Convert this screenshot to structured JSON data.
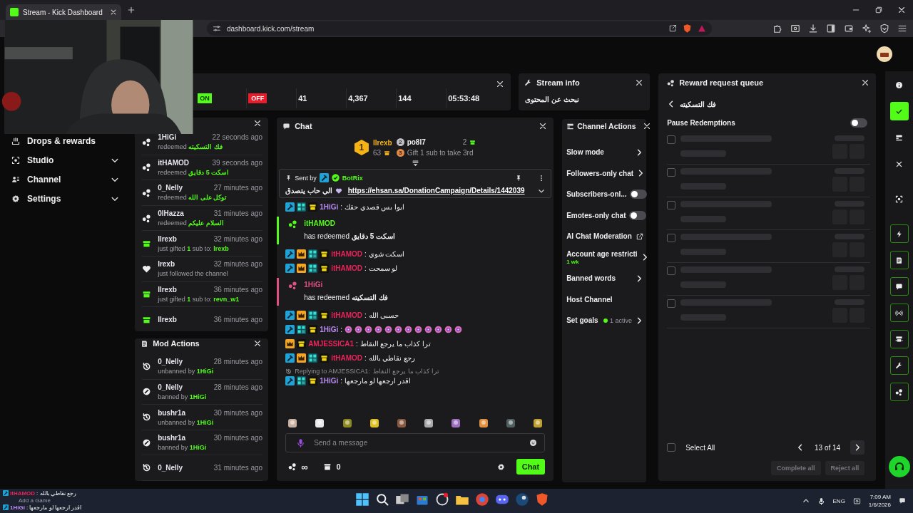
{
  "browser": {
    "tab_title": "Stream - Kick Dashboard",
    "url": "dashboard.kick.com/stream"
  },
  "sidebar": {
    "items": [
      {
        "label": "Drops & rewards",
        "expandable": false
      },
      {
        "label": "Studio",
        "expandable": true
      },
      {
        "label": "Channel",
        "expandable": true
      },
      {
        "label": "Settings",
        "expandable": true
      }
    ]
  },
  "stats": {
    "values": [
      {
        "kind": "status_on",
        "text": "ON"
      },
      {
        "kind": "status_off",
        "text": "OFF"
      },
      {
        "kind": "number",
        "text": "41"
      },
      {
        "kind": "number",
        "text": "4,367"
      },
      {
        "kind": "number",
        "text": "144"
      },
      {
        "kind": "number",
        "text": "05:53:48"
      }
    ]
  },
  "stream_info": {
    "title": "Stream info",
    "text": "نبحث عن المحتوى"
  },
  "activity_feed": {
    "items": [
      {
        "kind": "redeem",
        "user": "1HiGi",
        "time": "22 seconds ago",
        "line": [
          {
            "text": "redeemed ",
            "highlight": false
          },
          {
            "text": "فك التسكيته",
            "highlight": true
          }
        ]
      },
      {
        "kind": "redeem",
        "user": "itHAMOD",
        "time": "39 seconds ago",
        "line": [
          {
            "text": "redeemed ",
            "highlight": false
          },
          {
            "text": "اسكت 5 دقايق",
            "highlight": true
          }
        ]
      },
      {
        "kind": "redeem",
        "user": "0_Nelly",
        "time": "27 minutes ago",
        "line": [
          {
            "text": "redeemed ",
            "highlight": false
          },
          {
            "text": "توكل على الله",
            "highlight": true
          }
        ]
      },
      {
        "kind": "redeem",
        "user": "0lHazza",
        "time": "31 minutes ago",
        "line": [
          {
            "text": "redeemed ",
            "highlight": false
          },
          {
            "text": "السلام عليكم",
            "highlight": true
          }
        ]
      },
      {
        "kind": "gift",
        "user": "llrexb",
        "time": "32 minutes ago",
        "line": [
          {
            "text": "just gifted ",
            "highlight": false
          },
          {
            "text": "1",
            "highlight": true
          },
          {
            "text": " sub to: ",
            "highlight": false
          },
          {
            "text": "lrexb",
            "highlight": true
          }
        ]
      },
      {
        "kind": "follow",
        "user": "lrexb",
        "time": "32 minutes ago",
        "line": [
          {
            "text": "just followed the channel",
            "highlight": false
          }
        ]
      },
      {
        "kind": "gift",
        "user": "llrexb",
        "time": "36 minutes ago",
        "line": [
          {
            "text": "just gifted ",
            "highlight": false
          },
          {
            "text": "1",
            "highlight": true
          },
          {
            "text": " sub to: ",
            "highlight": false
          },
          {
            "text": "revn_w1",
            "highlight": true
          }
        ]
      },
      {
        "kind": "gift",
        "user": "llrexb",
        "time": "36 minutes ago"
      }
    ]
  },
  "mod_actions": {
    "title": "Mod Actions",
    "items": [
      {
        "kind": "unban",
        "user": "0_Nelly",
        "time": "28 minutes ago",
        "line": [
          {
            "text": "unbanned by ",
            "highlight": false
          },
          {
            "text": "1HiGi",
            "highlight": true
          }
        ]
      },
      {
        "kind": "ban",
        "user": "0_Nelly",
        "time": "28 minutes ago",
        "line": [
          {
            "text": "banned by ",
            "highlight": false
          },
          {
            "text": "1HiGi",
            "highlight": true
          }
        ]
      },
      {
        "kind": "unban",
        "user": "bushr1a",
        "time": "30 minutes ago",
        "line": [
          {
            "text": "unbanned by ",
            "highlight": false
          },
          {
            "text": "1HiGi",
            "highlight": true
          }
        ]
      },
      {
        "kind": "ban",
        "user": "bushr1a",
        "time": "30 minutes ago",
        "line": [
          {
            "text": "banned by ",
            "highlight": false
          },
          {
            "text": "1HiGi",
            "highlight": true
          }
        ]
      },
      {
        "kind": "unban",
        "user": "0_Nelly",
        "time": "31 minutes ago"
      }
    ]
  },
  "chat": {
    "title": "Chat",
    "leaderboard": [
      {
        "rank": "1",
        "user": "llrexb",
        "count": "63"
      },
      {
        "rank": "2",
        "user": "po8l7",
        "count": "2"
      },
      {
        "rank": "3",
        "text": "Gift 1 sub to take 3rd"
      }
    ],
    "pinned": {
      "label": "Sent by",
      "user": "BotRix",
      "text": "الي حاب يتصدق",
      "link": "https://ehsan.sa/DonationCampaign/Details/1442039"
    },
    "messages": [
      {
        "kind": "message",
        "badges": [
          {
            "kind": "mod"
          },
          {
            "kind": "og"
          },
          {
            "kind": "sub"
          }
        ],
        "user": "1HiGi",
        "color": "#b88cf0",
        "text": ": ايوا بس قصدي حقك"
      },
      {
        "kind": "redeem",
        "user": "itHAMOD",
        "color": "#53fc18",
        "action": "has redeemed ",
        "reward": "اسكت 5 دقايق"
      },
      {
        "kind": "message",
        "badges": [
          {
            "kind": "mod"
          },
          {
            "kind": "vip"
          },
          {
            "kind": "og"
          },
          {
            "kind": "sub"
          }
        ],
        "user": "itHAMOD",
        "color": "#e8245a",
        "text": ": اسكت شوي"
      },
      {
        "kind": "message",
        "badges": [
          {
            "kind": "mod"
          },
          {
            "kind": "vip"
          },
          {
            "kind": "og"
          },
          {
            "kind": "sub"
          }
        ],
        "user": "itHAMOD",
        "color": "#e8245a",
        "text": ": لو سمحت"
      },
      {
        "kind": "redeem",
        "user": "1HiGi",
        "color": "#e05080",
        "action": "has redeemed ",
        "reward": "فك التسكيته"
      },
      {
        "kind": "message",
        "badges": [
          {
            "kind": "mod"
          },
          {
            "kind": "vip"
          },
          {
            "kind": "og"
          },
          {
            "kind": "sub"
          }
        ],
        "user": "itHAMOD",
        "color": "#e8245a",
        "text": ": حسبي الله"
      },
      {
        "kind": "emotes",
        "badges": [
          {
            "kind": "mod"
          },
          {
            "kind": "og"
          },
          {
            "kind": "sub"
          }
        ],
        "user": "1HiGi",
        "color": "#b88cf0",
        "text": ":",
        "emotes": [
          {
            "kind": "donut"
          },
          {
            "kind": "donut"
          },
          {
            "kind": "donut"
          },
          {
            "kind": "donut"
          },
          {
            "kind": "donut"
          },
          {
            "kind": "donut"
          },
          {
            "kind": "donut"
          },
          {
            "kind": "donut"
          },
          {
            "kind": "donut"
          },
          {
            "kind": "donut"
          },
          {
            "kind": "donut"
          },
          {
            "kind": "donut"
          }
        ]
      },
      {
        "kind": "message",
        "badges": [
          {
            "kind": "vip"
          },
          {
            "kind": "sub"
          }
        ],
        "user": "AMJESSICA1",
        "color": "#e8245a",
        "text": ": ترا كذاب ما يرجع النقاط"
      },
      {
        "kind": "message",
        "badges": [
          {
            "kind": "mod"
          },
          {
            "kind": "vip"
          },
          {
            "kind": "og"
          },
          {
            "kind": "sub"
          }
        ],
        "user": "itHAMOD",
        "color": "#e8245a",
        "text": ": رجع نقاطي بالله"
      },
      {
        "kind": "message",
        "reply": {
          "label": "Replying to AMJESSICA1:",
          "quote": "ترا كذاب ما يرجع النقاط"
        },
        "badges": [
          {
            "kind": "mod"
          },
          {
            "kind": "og"
          },
          {
            "kind": "sub"
          }
        ],
        "user": "1HiGi",
        "color": "#b88cf0",
        "text": ": اقدر ارجعها لو مارجعها"
      }
    ],
    "input": {
      "placeholder": "Send a message"
    },
    "footer": {
      "points": "∞",
      "shop": "0"
    },
    "send_button": "Chat"
  },
  "channel_actions": {
    "title": "Channel Actions",
    "items": [
      {
        "kind": "nav",
        "label": "Slow mode"
      },
      {
        "kind": "nav",
        "label": "Followers-only chat"
      },
      {
        "kind": "toggle",
        "label": "Subscribers-onl...",
        "on": false
      },
      {
        "kind": "toggle",
        "label": "Emotes-only chat",
        "on": false
      },
      {
        "kind": "external",
        "label": "AI Chat Moderation"
      },
      {
        "kind": "nav",
        "label": "Account age restricti",
        "detail": "1 wk"
      },
      {
        "kind": "nav",
        "label": "Banned words"
      },
      {
        "kind": "plain",
        "label": "Host Channel"
      },
      {
        "kind": "nav",
        "label": "Set goals",
        "status": "1 active"
      }
    ]
  },
  "reward_queue": {
    "title": "Reward request queue",
    "reward": "فك التسكيته",
    "pause": {
      "label": "Pause Redemptions",
      "on": false
    },
    "rows": [
      {
        "checked": false
      },
      {
        "checked": false
      },
      {
        "checked": false
      },
      {
        "checked": false
      },
      {
        "checked": false
      },
      {
        "checked": false
      }
    ],
    "select_all": {
      "label": "Select All",
      "checked": false
    },
    "page": "13 of 14",
    "actions": [
      {
        "label": "Complete all",
        "disabled": true
      },
      {
        "label": "Reject all",
        "disabled": true
      }
    ]
  },
  "taskbar": {
    "ticker": [
      {
        "kind": "message",
        "user": "itHAMOD",
        "color": "#e8245a",
        "text": ": رجع نقاطي بالله"
      },
      {
        "kind": "hint",
        "text": "Add a Game"
      },
      {
        "kind": "message",
        "user": "1HiGi",
        "color": "#b88cf0",
        "text": ": اقدر ارجعها لو مارجعها"
      }
    ],
    "language": "ENG",
    "time": "7:09 AM",
    "date": "1/6/2026"
  }
}
